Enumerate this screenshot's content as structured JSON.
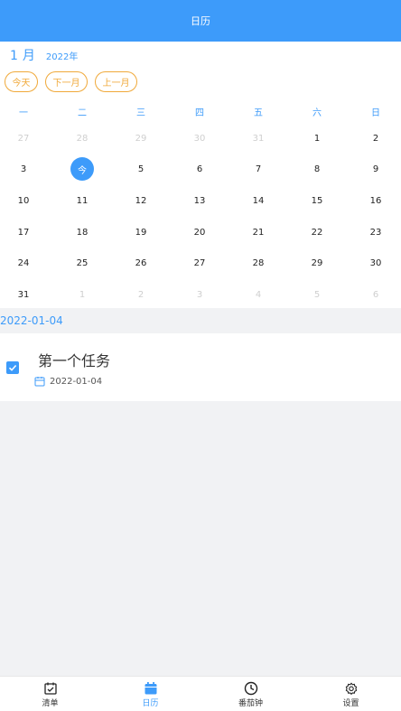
{
  "header": {
    "title": "日历"
  },
  "calendar": {
    "month_num": "1",
    "month_unit": "月",
    "year": "2022年",
    "buttons": {
      "today": "今天",
      "next": "下一月",
      "prev": "上一月"
    },
    "weekdays": [
      "一",
      "二",
      "三",
      "四",
      "五",
      "六",
      "日"
    ],
    "weeks": [
      [
        {
          "d": "27",
          "o": true
        },
        {
          "d": "28",
          "o": true
        },
        {
          "d": "29",
          "o": true
        },
        {
          "d": "30",
          "o": true
        },
        {
          "d": "31",
          "o": true
        },
        {
          "d": "1",
          "o": false
        },
        {
          "d": "2",
          "o": false
        }
      ],
      [
        {
          "d": "3",
          "o": false
        },
        {
          "d": "今",
          "o": false,
          "t": true
        },
        {
          "d": "5",
          "o": false
        },
        {
          "d": "6",
          "o": false
        },
        {
          "d": "7",
          "o": false
        },
        {
          "d": "8",
          "o": false
        },
        {
          "d": "9",
          "o": false
        }
      ],
      [
        {
          "d": "10",
          "o": false
        },
        {
          "d": "11",
          "o": false
        },
        {
          "d": "12",
          "o": false
        },
        {
          "d": "13",
          "o": false
        },
        {
          "d": "14",
          "o": false
        },
        {
          "d": "15",
          "o": false
        },
        {
          "d": "16",
          "o": false
        }
      ],
      [
        {
          "d": "17",
          "o": false
        },
        {
          "d": "18",
          "o": false
        },
        {
          "d": "19",
          "o": false
        },
        {
          "d": "20",
          "o": false
        },
        {
          "d": "21",
          "o": false
        },
        {
          "d": "22",
          "o": false
        },
        {
          "d": "23",
          "o": false
        }
      ],
      [
        {
          "d": "24",
          "o": false
        },
        {
          "d": "25",
          "o": false
        },
        {
          "d": "26",
          "o": false
        },
        {
          "d": "27",
          "o": false
        },
        {
          "d": "28",
          "o": false
        },
        {
          "d": "29",
          "o": false
        },
        {
          "d": "30",
          "o": false
        }
      ],
      [
        {
          "d": "31",
          "o": false
        },
        {
          "d": "1",
          "o": true
        },
        {
          "d": "2",
          "o": true
        },
        {
          "d": "3",
          "o": true
        },
        {
          "d": "4",
          "o": true
        },
        {
          "d": "5",
          "o": true
        },
        {
          "d": "6",
          "o": true
        }
      ]
    ]
  },
  "selected_date": "2022-01-04",
  "task": {
    "title": "第一个任务",
    "date": "2022-01-04",
    "checked": true
  },
  "nav": [
    {
      "label": "清单",
      "icon": "checklist-icon",
      "active": false
    },
    {
      "label": "日历",
      "icon": "calendar-icon",
      "active": true
    },
    {
      "label": "番茄钟",
      "icon": "clock-icon",
      "active": false
    },
    {
      "label": "设置",
      "icon": "gear-icon",
      "active": false
    }
  ],
  "colors": {
    "primary": "#3d9bfa",
    "accent": "#f0a93a"
  }
}
